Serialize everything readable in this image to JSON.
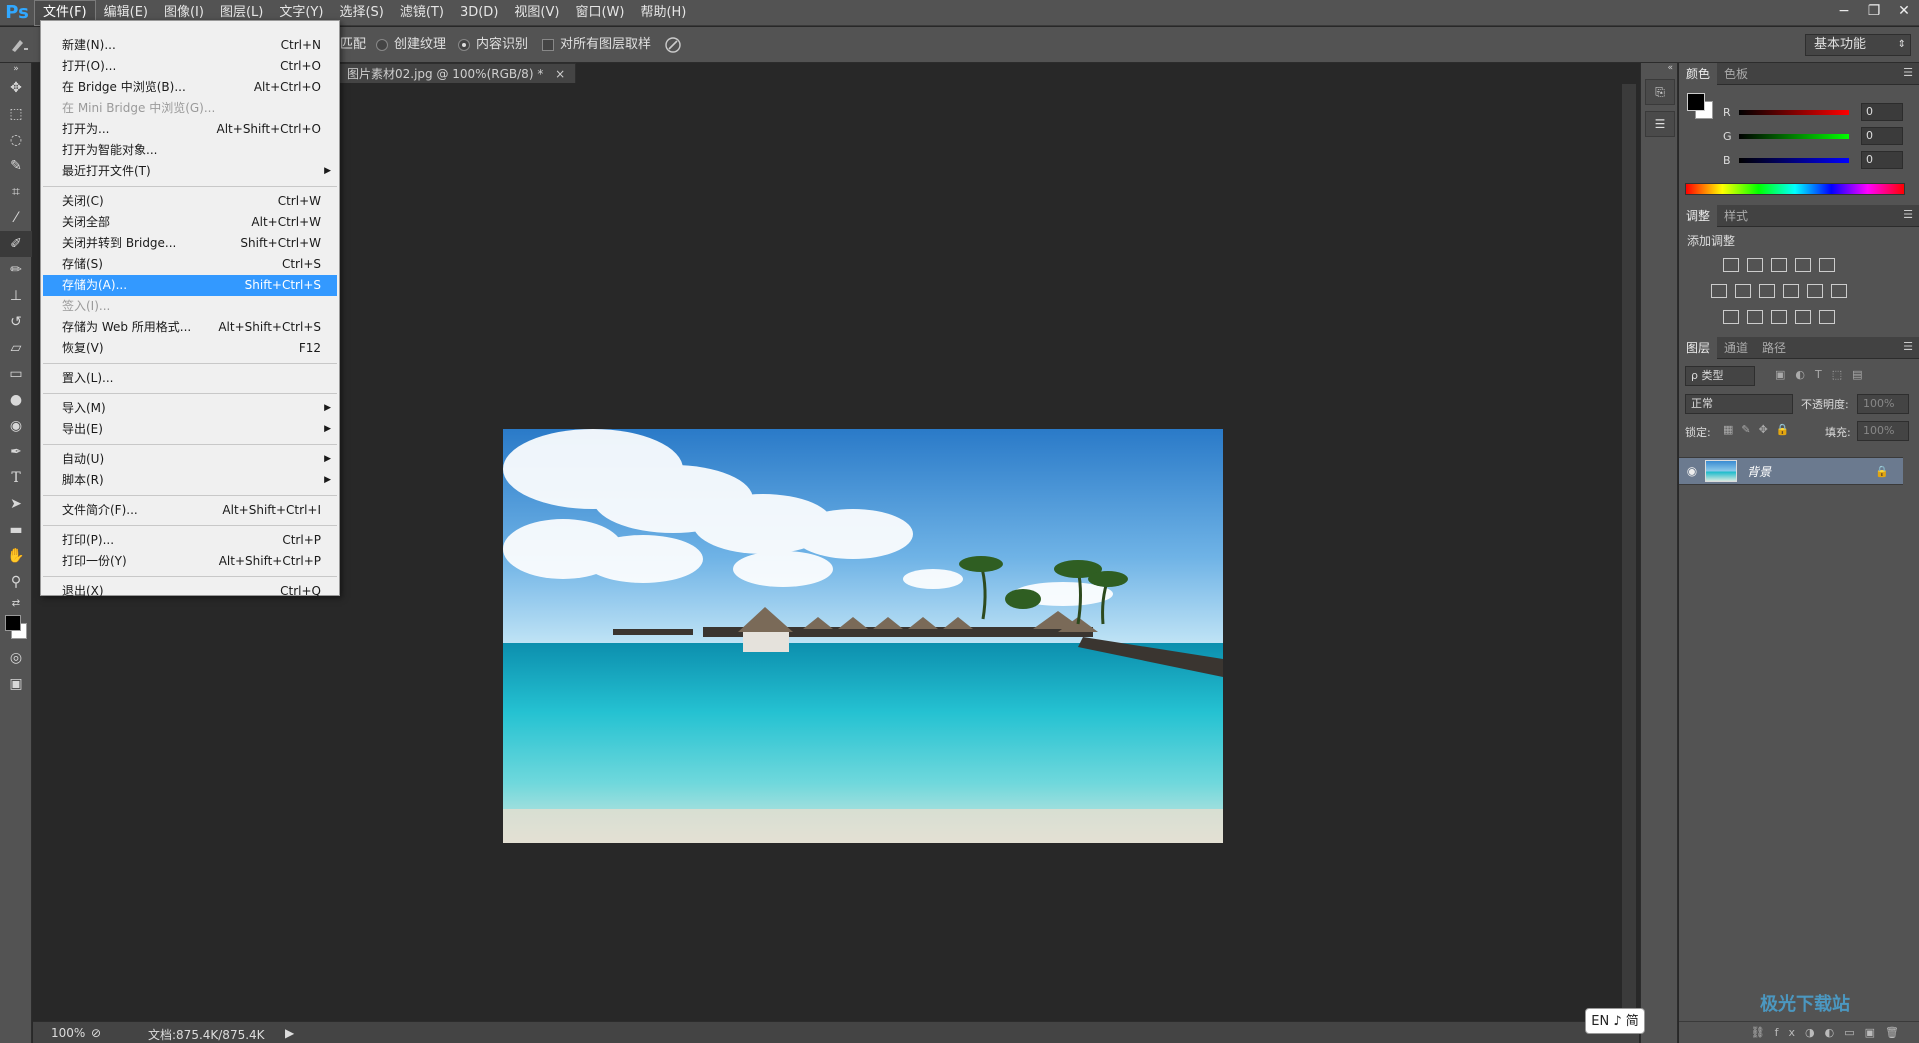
{
  "app": {
    "logo": "Ps"
  },
  "menubar": {
    "items": [
      "文件(F)",
      "编辑(E)",
      "图像(I)",
      "图层(L)",
      "文字(Y)",
      "选择(S)",
      "滤镜(T)",
      "3D(D)",
      "视图(V)",
      "窗口(W)",
      "帮助(H)"
    ],
    "active_index": 0
  },
  "window_controls": {
    "minimize": "−",
    "restore": "❐",
    "close": "✕"
  },
  "options_bar": {
    "match_label": "匹配",
    "create_texture": "创建纹理",
    "content_aware": "内容识别",
    "sample_all_layers": "对所有图层取样",
    "workspace": "基本功能"
  },
  "document": {
    "tab_title": "图片素材02.jpg @ 100%(RGB/8) *",
    "tab_close": "×"
  },
  "status_bar": {
    "zoom": "100%",
    "doc_size": "文档:875.4K/875.4K"
  },
  "file_menu": {
    "items": [
      {
        "label": "新建(N)...",
        "shortcut": "Ctrl+N"
      },
      {
        "label": "打开(O)...",
        "shortcut": "Ctrl+O"
      },
      {
        "label": "在 Bridge 中浏览(B)...",
        "shortcut": "Alt+Ctrl+O"
      },
      {
        "label": "在 Mini Bridge 中浏览(G)...",
        "shortcut": "",
        "disabled": true
      },
      {
        "label": "打开为...",
        "shortcut": "Alt+Shift+Ctrl+O"
      },
      {
        "label": "打开为智能对象...",
        "shortcut": ""
      },
      {
        "label": "最近打开文件(T)",
        "shortcut": "",
        "submenu": true
      },
      {
        "label": "关闭(C)",
        "shortcut": "Ctrl+W"
      },
      {
        "label": "关闭全部",
        "shortcut": "Alt+Ctrl+W"
      },
      {
        "label": "关闭并转到 Bridge...",
        "shortcut": "Shift+Ctrl+W"
      },
      {
        "label": "存储(S)",
        "shortcut": "Ctrl+S"
      },
      {
        "label": "存储为(A)...",
        "shortcut": "Shift+Ctrl+S",
        "highlighted": true
      },
      {
        "label": "签入(I)...",
        "shortcut": "",
        "disabled": true
      },
      {
        "label": "存储为 Web 所用格式...",
        "shortcut": "Alt+Shift+Ctrl+S"
      },
      {
        "label": "恢复(V)",
        "shortcut": "F12"
      },
      {
        "label": "置入(L)...",
        "shortcut": ""
      },
      {
        "label": "导入(M)",
        "shortcut": "",
        "submenu": true
      },
      {
        "label": "导出(E)",
        "shortcut": "",
        "submenu": true
      },
      {
        "label": "自动(U)",
        "shortcut": "",
        "submenu": true
      },
      {
        "label": "脚本(R)",
        "shortcut": "",
        "submenu": true
      },
      {
        "label": "文件简介(F)...",
        "shortcut": "Alt+Shift+Ctrl+I"
      },
      {
        "label": "打印(P)...",
        "shortcut": "Ctrl+P"
      },
      {
        "label": "打印一份(Y)",
        "shortcut": "Alt+Shift+Ctrl+P"
      },
      {
        "label": "退出(X)",
        "shortcut": "Ctrl+Q"
      }
    ]
  },
  "color_panel": {
    "tabs": [
      "颜色",
      "色板"
    ],
    "channels": [
      {
        "label": "R",
        "value": "0"
      },
      {
        "label": "G",
        "value": "0"
      },
      {
        "label": "B",
        "value": "0"
      }
    ]
  },
  "adjust_panel": {
    "tabs": [
      "调整",
      "样式"
    ],
    "title": "添加调整"
  },
  "layers_panel": {
    "tabs": [
      "图层",
      "通道",
      "路径"
    ],
    "filter": "ρ 类型",
    "blend_mode": "正常",
    "opacity_label": "不透明度:",
    "opacity_value": "100%",
    "lock_label": "锁定:",
    "fill_label": "填充:",
    "fill_value": "100%",
    "layer_name": "背景"
  },
  "ime": {
    "text": "EN ♪ 简"
  },
  "watermark": {
    "text": "极光下载站"
  },
  "colors": {
    "selection": "#3399ff",
    "ps_blue": "#31a8ff"
  }
}
